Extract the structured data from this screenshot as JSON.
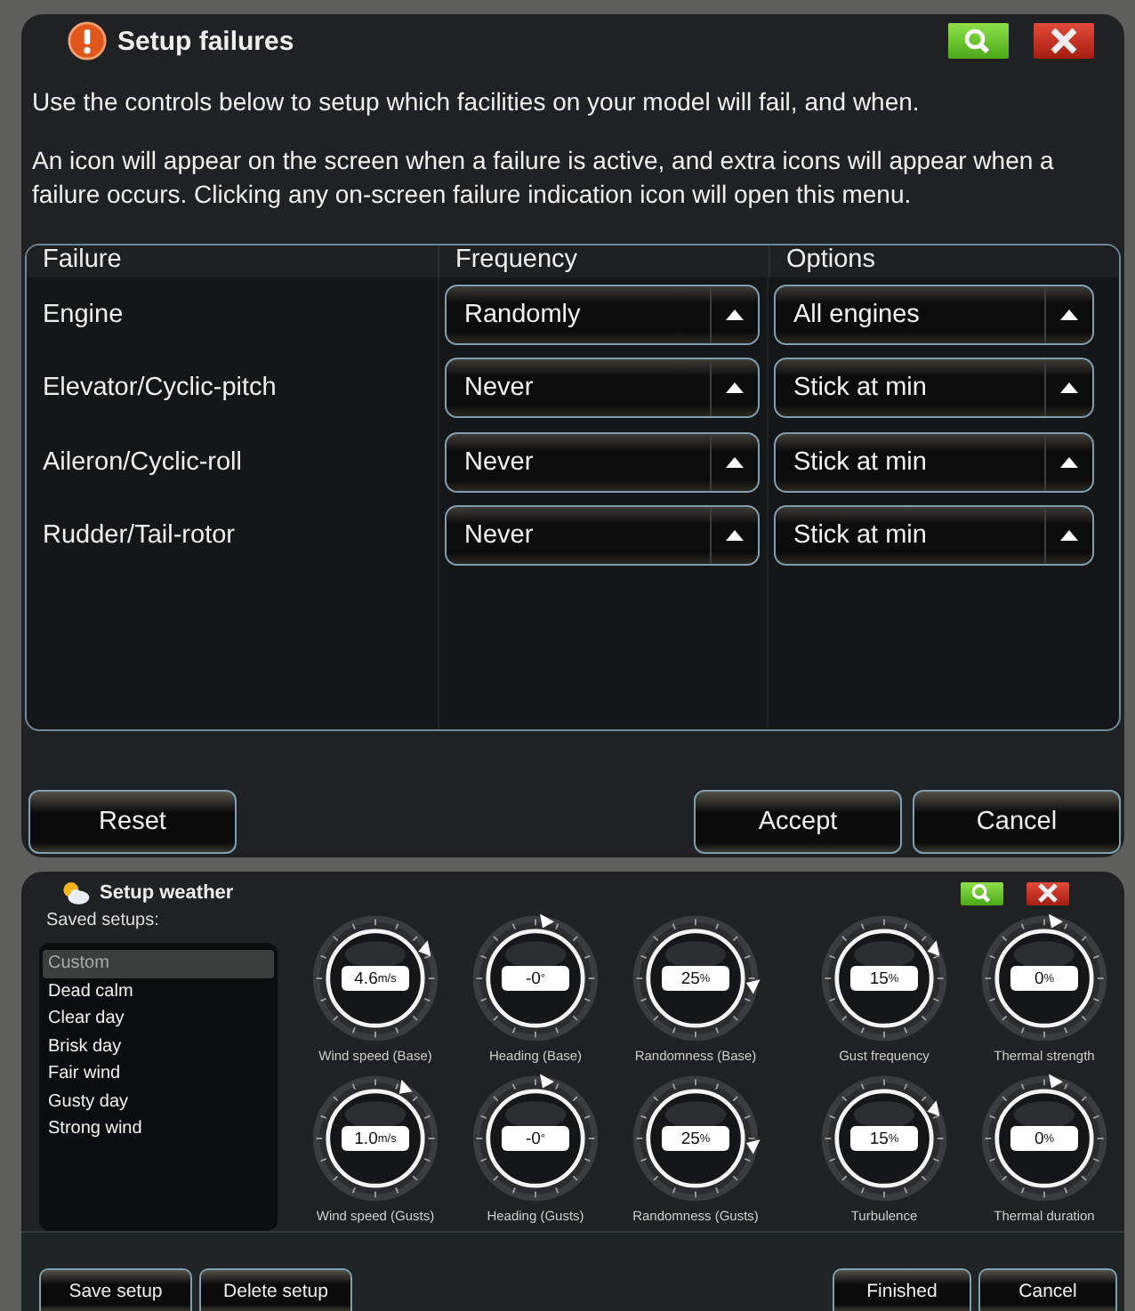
{
  "failures_dialog": {
    "title": "Setup failures",
    "intro": [
      "Use the controls below to setup which facilities on your model will fail, and when.",
      "An icon will appear on the screen when a failure is active, and extra icons will appear when a failure occurs. Clicking any on-screen failure indication icon will open this menu."
    ],
    "columns": [
      "Failure",
      "Frequency",
      "Options"
    ],
    "rows": [
      {
        "failure": "Engine",
        "frequency": "Randomly",
        "option": "All engines"
      },
      {
        "failure": "Elevator/Cyclic-pitch",
        "frequency": "Never",
        "option": "Stick at min"
      },
      {
        "failure": "Aileron/Cyclic-roll",
        "frequency": "Never",
        "option": "Stick at min"
      },
      {
        "failure": "Rudder/Tail-rotor",
        "frequency": "Never",
        "option": "Stick at min"
      }
    ],
    "buttons": {
      "left": [
        "Reset"
      ],
      "right": [
        "Accept",
        "Cancel"
      ]
    }
  },
  "weather_dialog": {
    "title": "Setup weather",
    "saved_label": "Saved setups:",
    "saved_setups": [
      {
        "label": "Custom",
        "selected": true
      },
      {
        "label": "Dead calm",
        "selected": false
      },
      {
        "label": "Clear day",
        "selected": false
      },
      {
        "label": "Brisk day",
        "selected": false
      },
      {
        "label": "Fair wind",
        "selected": false
      },
      {
        "label": "Gusty day",
        "selected": false
      },
      {
        "label": "Strong wind",
        "selected": false
      }
    ],
    "dials": [
      [
        {
          "value": "4.6",
          "unit": "m/s",
          "label": "Wind speed (Base)"
        },
        {
          "value": "-0",
          "unit": "°",
          "label": "Heading (Base)"
        },
        {
          "value": "25",
          "unit": "%",
          "label": "Randomness (Base)"
        },
        {
          "value": "15",
          "unit": "%",
          "label": "Gust frequency"
        },
        {
          "value": "0",
          "unit": "%",
          "label": "Thermal strength"
        }
      ],
      [
        {
          "value": "1.0",
          "unit": "m/s",
          "label": "Wind speed (Gusts)"
        },
        {
          "value": "-0",
          "unit": "°",
          "label": "Heading (Gusts)"
        },
        {
          "value": "25",
          "unit": "%",
          "label": "Randomness (Gusts)"
        },
        {
          "value": "15",
          "unit": "%",
          "label": "Turbulence"
        },
        {
          "value": "0",
          "unit": "%",
          "label": "Thermal duration"
        }
      ]
    ],
    "buttons": {
      "left": [
        "Save setup",
        "Delete setup"
      ],
      "right": [
        "Finished",
        "Cancel"
      ]
    }
  }
}
